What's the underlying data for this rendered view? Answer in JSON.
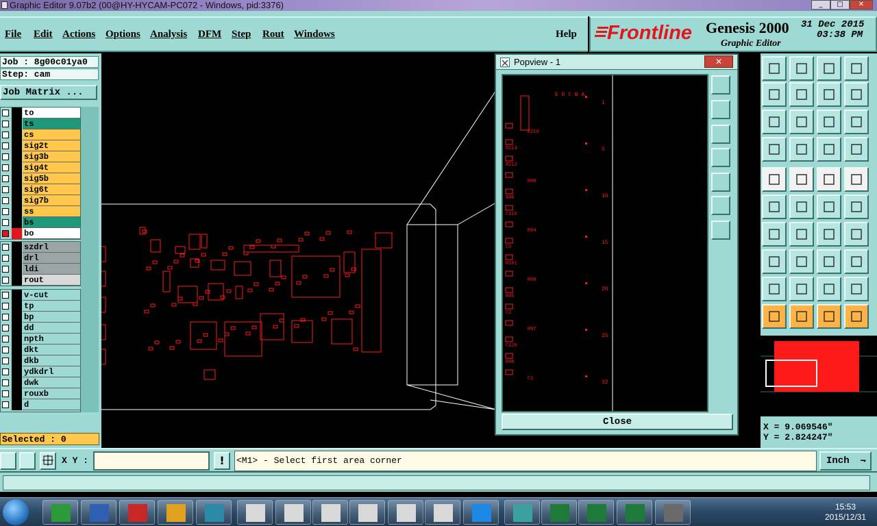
{
  "window": {
    "title": "Graphic Editor 9.07b2 (00@HY-HYCAM-PC072 - Windows, pid:3376)"
  },
  "menu": [
    {
      "label": "File"
    },
    {
      "label": "Edit"
    },
    {
      "label": "Actions"
    },
    {
      "label": "Options"
    },
    {
      "label": "Analysis"
    },
    {
      "label": "DFM"
    },
    {
      "label": "Step"
    },
    {
      "label": "Rout"
    },
    {
      "label": "Windows"
    }
  ],
  "help_label": "Help",
  "brand": {
    "logo": "Frontline",
    "product": "Genesis 2000",
    "subtitle": "Graphic Editor",
    "date": "31 Dec 2015",
    "time": "03:38 PM",
    "logo_color": "#e4161d"
  },
  "job": {
    "job_label": "Job : 8g00c01ya0",
    "step_label": "Step: cam",
    "matrix_button": "Job Matrix ..."
  },
  "layers_group1": [
    {
      "name": "to",
      "bg": "#ffffff"
    },
    {
      "name": "ts",
      "bg": "#1e9a7a"
    },
    {
      "name": "cs",
      "bg": "#ffc84d"
    },
    {
      "name": "sig2t",
      "bg": "#ffc84d"
    },
    {
      "name": "sig3b",
      "bg": "#ffc84d"
    },
    {
      "name": "sig4t",
      "bg": "#ffc84d"
    },
    {
      "name": "sig5b",
      "bg": "#ffc84d"
    },
    {
      "name": "sig6t",
      "bg": "#ffc84d"
    },
    {
      "name": "sig7b",
      "bg": "#ffc84d"
    },
    {
      "name": "ss",
      "bg": "#ffc84d"
    },
    {
      "name": "bs",
      "bg": "#1e9a7a"
    },
    {
      "name": "bo",
      "bg": "#ffffff",
      "active": true
    }
  ],
  "layers_group2": [
    {
      "name": "szdrl",
      "bg": "#9aa6a4"
    },
    {
      "name": "drl",
      "bg": "#9aa6a4"
    },
    {
      "name": "ldi",
      "bg": "#9aa6a4"
    },
    {
      "name": "rout",
      "bg": "#d9d9d9"
    }
  ],
  "layers_group3": [
    {
      "name": "v-cut",
      "bg": "#9ed9d3"
    },
    {
      "name": "tp",
      "bg": "#9ed9d3"
    },
    {
      "name": "bp",
      "bg": "#9ed9d3"
    },
    {
      "name": "dd",
      "bg": "#9ed9d3"
    },
    {
      "name": "npth",
      "bg": "#9ed9d3"
    },
    {
      "name": "dkt",
      "bg": "#9ed9d3"
    },
    {
      "name": "dkb",
      "bg": "#9ed9d3"
    },
    {
      "name": "ydkdrl",
      "bg": "#9ed9d3"
    },
    {
      "name": "dwk",
      "bg": "#9ed9d3"
    },
    {
      "name": "rouxb",
      "bg": "#9ed9d3"
    },
    {
      "name": "d",
      "bg": "#9ed9d3"
    }
  ],
  "selected_label": "Selected : 0",
  "popview": {
    "title": "Popview - 1",
    "close_label": "Close",
    "ruler_top": "E D C B A",
    "ruler_numbers": [
      "1",
      "5",
      "10",
      "15",
      "20",
      "25",
      "32"
    ],
    "ref_labels": [
      "R218",
      "R214",
      "R212",
      "R08",
      "R06",
      "C110",
      "R04",
      "C3",
      "R101",
      "R09",
      "R05",
      "C2",
      "R07",
      "C120",
      "R08",
      "C1"
    ]
  },
  "coords": {
    "x_label": "X = 9.069546\"",
    "y_label": "Y = 2.824247\""
  },
  "bottom": {
    "xy_label": "X Y :",
    "xy_value": "",
    "message": "<M1> - Select first area corner",
    "unit": "Inch"
  },
  "clock": {
    "time": "15:53",
    "date": "2015/12/31"
  },
  "colors": {
    "panel": "#9ed9d3",
    "pcb": "#ff1a1a",
    "highlight": "#ffc84d"
  }
}
